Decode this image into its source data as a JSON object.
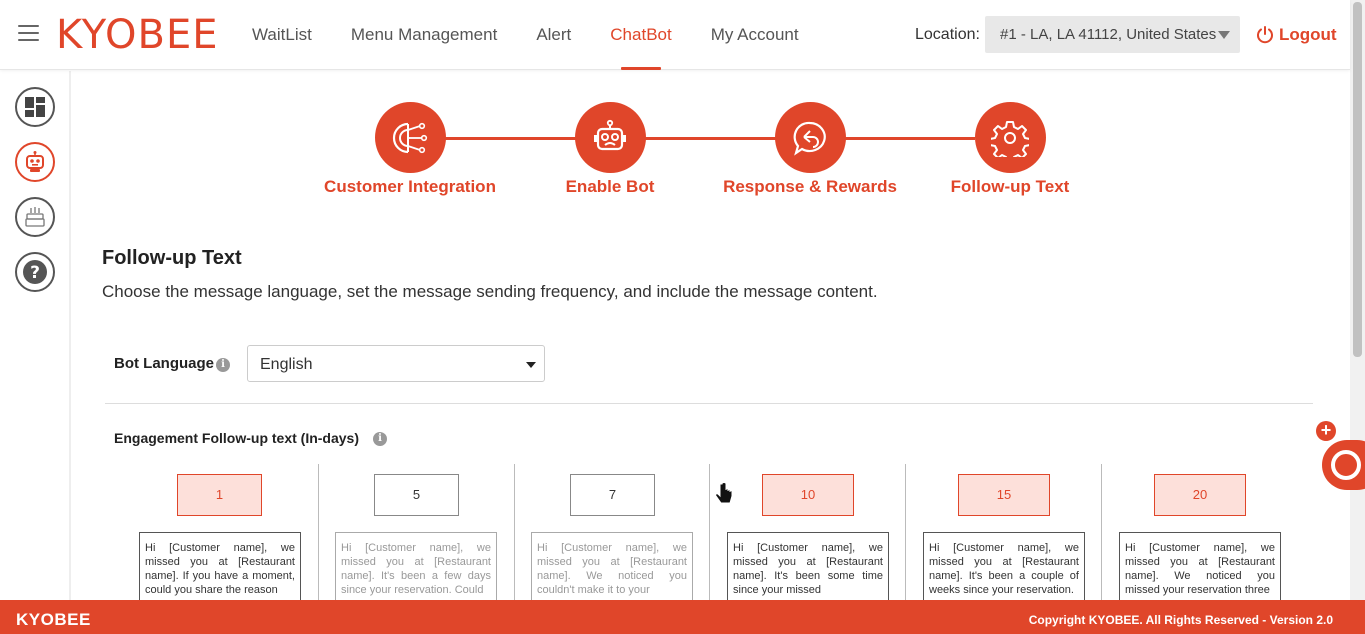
{
  "header": {
    "logo": "KYOBEE",
    "nav": [
      {
        "label": "WaitList"
      },
      {
        "label": "Menu Management"
      },
      {
        "label": "Alert"
      },
      {
        "label": "ChatBot"
      },
      {
        "label": "My Account"
      }
    ],
    "active_nav": "ChatBot",
    "location_label": "Location:",
    "location_value": "#1 - LA, LA 41112, United States",
    "logout_label": "Logout"
  },
  "sidebar": {
    "items": [
      {
        "icon": "dashboard-icon"
      },
      {
        "icon": "robot-icon",
        "active": true
      },
      {
        "icon": "cake-icon"
      },
      {
        "icon": "help-icon"
      }
    ]
  },
  "steps": [
    {
      "label": "Customer Integration",
      "icon": "integration-icon"
    },
    {
      "label": "Enable Bot",
      "icon": "robot-icon"
    },
    {
      "label": "Response & Rewards",
      "icon": "reply-chat-icon"
    },
    {
      "label": "Follow-up Text",
      "icon": "gear-icon"
    }
  ],
  "section": {
    "title": "Follow-up Text",
    "description": "Choose the message language, set the message sending frequency, and include the message content."
  },
  "bot_language": {
    "label": "Bot Language",
    "value": "English"
  },
  "engagement": {
    "label": "Engagement Follow-up text (In-days)",
    "days": [
      {
        "value": "1",
        "active": true,
        "message": "Hi [Customer name], we missed you at [Restaurant name]. If you have a moment, could you share the reason"
      },
      {
        "value": "5",
        "active": false,
        "message": "Hi [Customer name], we missed you at [Restaurant name]. It's been a few days since your reservation. Could"
      },
      {
        "value": "7",
        "active": false,
        "message": "Hi [Customer name], we missed you at [Restaurant name]. We noticed you couldn't make it to your"
      },
      {
        "value": "10",
        "active": true,
        "message": "Hi [Customer name], we missed you at [Restaurant name]. It's been some time since your missed"
      },
      {
        "value": "15",
        "active": true,
        "message": "Hi [Customer name], we missed you at [Restaurant name]. It's been a couple of weeks since your reservation."
      },
      {
        "value": "20",
        "active": true,
        "message": "Hi [Customer name], we missed you at [Restaurant name]. We noticed you missed your reservation three"
      }
    ]
  },
  "footer": {
    "brand": "KYOBEE",
    "copyright": "Copyright KYOBEE. All Rights Reserved - Version 2.0"
  },
  "colors": {
    "accent": "#e0462a",
    "active_day_bg": "#fde0da"
  }
}
